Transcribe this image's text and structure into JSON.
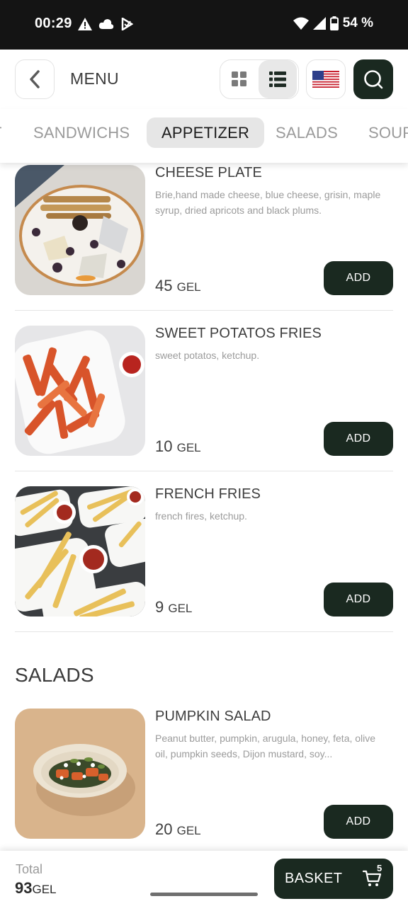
{
  "status_bar": {
    "time": "00:29",
    "battery": "54 %",
    "icons": [
      "warning-icon",
      "cloud-icon",
      "play-icon",
      "wifi-icon",
      "signal-icon",
      "battery-icon"
    ]
  },
  "header": {
    "title": "MENU",
    "back_icon": "chevron-left-icon",
    "view_options": [
      "grid-view-icon",
      "list-view-icon"
    ],
    "active_view": "list",
    "language_icon": "us-flag-icon",
    "search_icon": "search-icon"
  },
  "tabs": [
    {
      "label": "T",
      "active": false
    },
    {
      "label": "SANDWICHS",
      "active": false
    },
    {
      "label": "APPETIZER",
      "active": true
    },
    {
      "label": "SALADS",
      "active": false
    },
    {
      "label": "SOUP",
      "active": false
    }
  ],
  "items": [
    {
      "name": "CHEESE PLATE",
      "description": "Brie,hand made cheese, blue cheese, grisin, maple syrup, dried apricots and black plums.",
      "price": "45",
      "currency": "GEL",
      "add_label": "ADD"
    },
    {
      "name": "SWEET POTATOS FRIES",
      "description": "sweet potatos, ketchup.",
      "price": "10",
      "currency": "GEL",
      "add_label": "ADD"
    },
    {
      "name": "FRENCH FRIES",
      "description": "french fires, ketchup.",
      "price": "9",
      "currency": "GEL",
      "add_label": "ADD"
    }
  ],
  "salads_section": {
    "title": "SALADS",
    "items": [
      {
        "name": "PUMPKIN SALAD",
        "description": "Peanut butter, pumpkin, arugula, honey, feta, olive oil, pumpkin seeds, Dijon mustard, soy...",
        "price": "20",
        "currency": "GEL",
        "add_label": "ADD"
      }
    ]
  },
  "bottom_bar": {
    "total_label": "Total",
    "total_value": "93",
    "total_currency": "GEL",
    "basket_label": "BASKET",
    "basket_count": "5",
    "cart_icon": "cart-icon"
  },
  "colors": {
    "accent_dark": "#1a2920",
    "status_bar": "#141414",
    "active_tab_bg": "#e6e6e6",
    "muted_text": "#9a9a9a"
  }
}
